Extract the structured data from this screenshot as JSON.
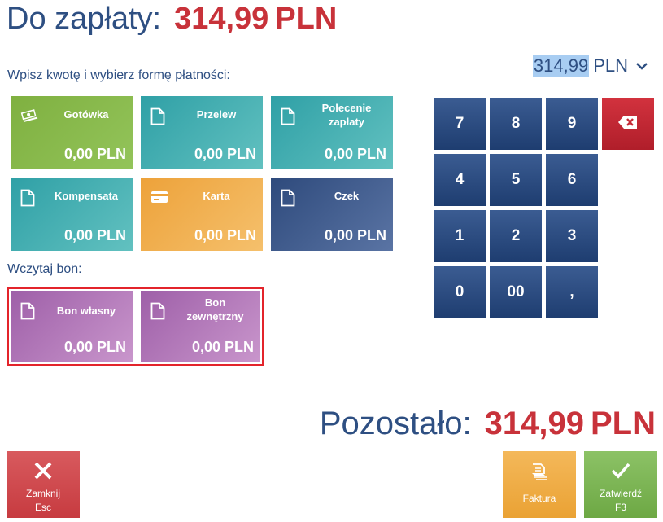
{
  "header": {
    "label": "Do zapłaty:",
    "amount": "314,99",
    "currency": "PLN"
  },
  "instructions": "Wpisz kwotę i wybierz formę płatności:",
  "amount_input": {
    "value": "314,99",
    "currency": "PLN",
    "icon": "chevron-down-icon"
  },
  "payment_methods": [
    {
      "name": "Gotówka",
      "value": "0,00 PLN",
      "icon": "cash-icon",
      "color": "#7fb040"
    },
    {
      "name": "Przelew",
      "value": "0,00 PLN",
      "icon": "document-icon",
      "color": "#2fa0a6"
    },
    {
      "name": "Polecenie\nzapłaty",
      "value": "0,00 PLN",
      "icon": "document-icon",
      "color": "#2fa0a6"
    },
    {
      "name": "Kompensata",
      "value": "0,00 PLN",
      "icon": "document-icon",
      "color": "#2fa0a6"
    },
    {
      "name": "Karta",
      "value": "0,00 PLN",
      "icon": "card-icon",
      "color": "#eda23a"
    },
    {
      "name": "Czek",
      "value": "0,00 PLN",
      "icon": "document-icon",
      "color": "#2e4a7c"
    }
  ],
  "voucher": {
    "label": "Wczytaj bon:",
    "items": [
      {
        "name": "Bon własny",
        "value": "0,00 PLN",
        "icon": "document-icon",
        "color": "#9e5fa8"
      },
      {
        "name": "Bon\nzewnętrzny",
        "value": "0,00 PLN",
        "icon": "document-icon",
        "color": "#9e5fa8"
      }
    ],
    "highlight_color": "#e3242b"
  },
  "keypad": {
    "keys": [
      "7",
      "8",
      "9",
      "4",
      "5",
      "6",
      "1",
      "2",
      "3",
      "0",
      "00",
      ","
    ],
    "backspace_icon": "backspace-icon"
  },
  "remaining": {
    "label": "Pozostało:",
    "amount": "314,99",
    "currency": "PLN"
  },
  "actions": {
    "close": {
      "label": "Zamknij",
      "shortcut": "Esc",
      "icon": "close-icon",
      "color": "#c73b40"
    },
    "invoice": {
      "label": "Faktura",
      "icon": "invoice-icon",
      "color": "#eaa234"
    },
    "confirm": {
      "label": "Zatwierdź",
      "shortcut": "F3",
      "icon": "checkmark-icon",
      "color": "#6da844"
    }
  },
  "colors": {
    "navy": "#2e4f82",
    "accent_red": "#c8323a"
  }
}
